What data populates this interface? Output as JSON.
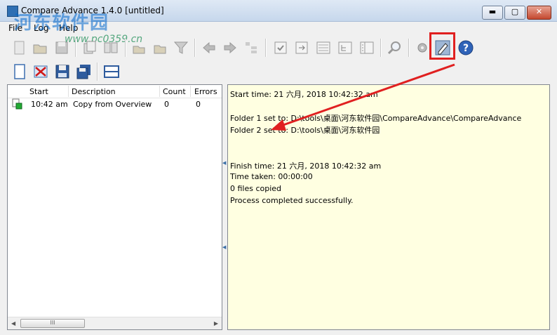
{
  "window": {
    "title": "Compare Advance 1.4.0 [untitled]",
    "min_glyph": "▬",
    "max_glyph": "▢",
    "close_glyph": "✕"
  },
  "watermark": {
    "text": "河东软件园",
    "url": "www.pc0359.cn"
  },
  "menu": {
    "items": [
      "File",
      "Log",
      "Help"
    ]
  },
  "toolbar": {
    "icons": [
      "new-icon",
      "open-icon",
      "save-icon",
      "copy-icon",
      "compare-icon",
      "sync-icon",
      "filter-icon",
      "move-left-icon",
      "move-right-icon",
      "tree-icon",
      "checkbox-icon",
      "export-icon",
      "list-icon",
      "hierarchy-icon",
      "details-icon",
      "search-icon",
      "tools-icon",
      "log-icon",
      "help-icon"
    ]
  },
  "toolbar2": {
    "icons": [
      "blank-page-icon",
      "delete-icon",
      "save-floppy-icon",
      "save-all-icon",
      "split-view-icon"
    ]
  },
  "log_list": {
    "columns": [
      "Start",
      "Description",
      "Count",
      "Errors"
    ],
    "rows": [
      {
        "start": "10:42 am",
        "description": "Copy from Overview",
        "count": "0",
        "errors": "0"
      }
    ],
    "scroll_thumb": "III"
  },
  "log_output": {
    "lines": [
      "Start time: 21 六月, 2018 10:42:32 am",
      "",
      "Folder 1 set to: D:\\tools\\桌面\\河东软件园\\CompareAdvance\\CompareAdvance",
      "Folder 2 set to: D:\\tools\\桌面\\河东软件园",
      "",
      "",
      "",
      "Finish time: 21 六月, 2018 10:42:32 am",
      "Time taken: 00:00:00",
      "0 files copied",
      "Process completed successfully."
    ]
  },
  "colors": {
    "log_background": "#ffffe1",
    "annotation_red": "#e02020",
    "titlebar": "#c6d7ec"
  }
}
